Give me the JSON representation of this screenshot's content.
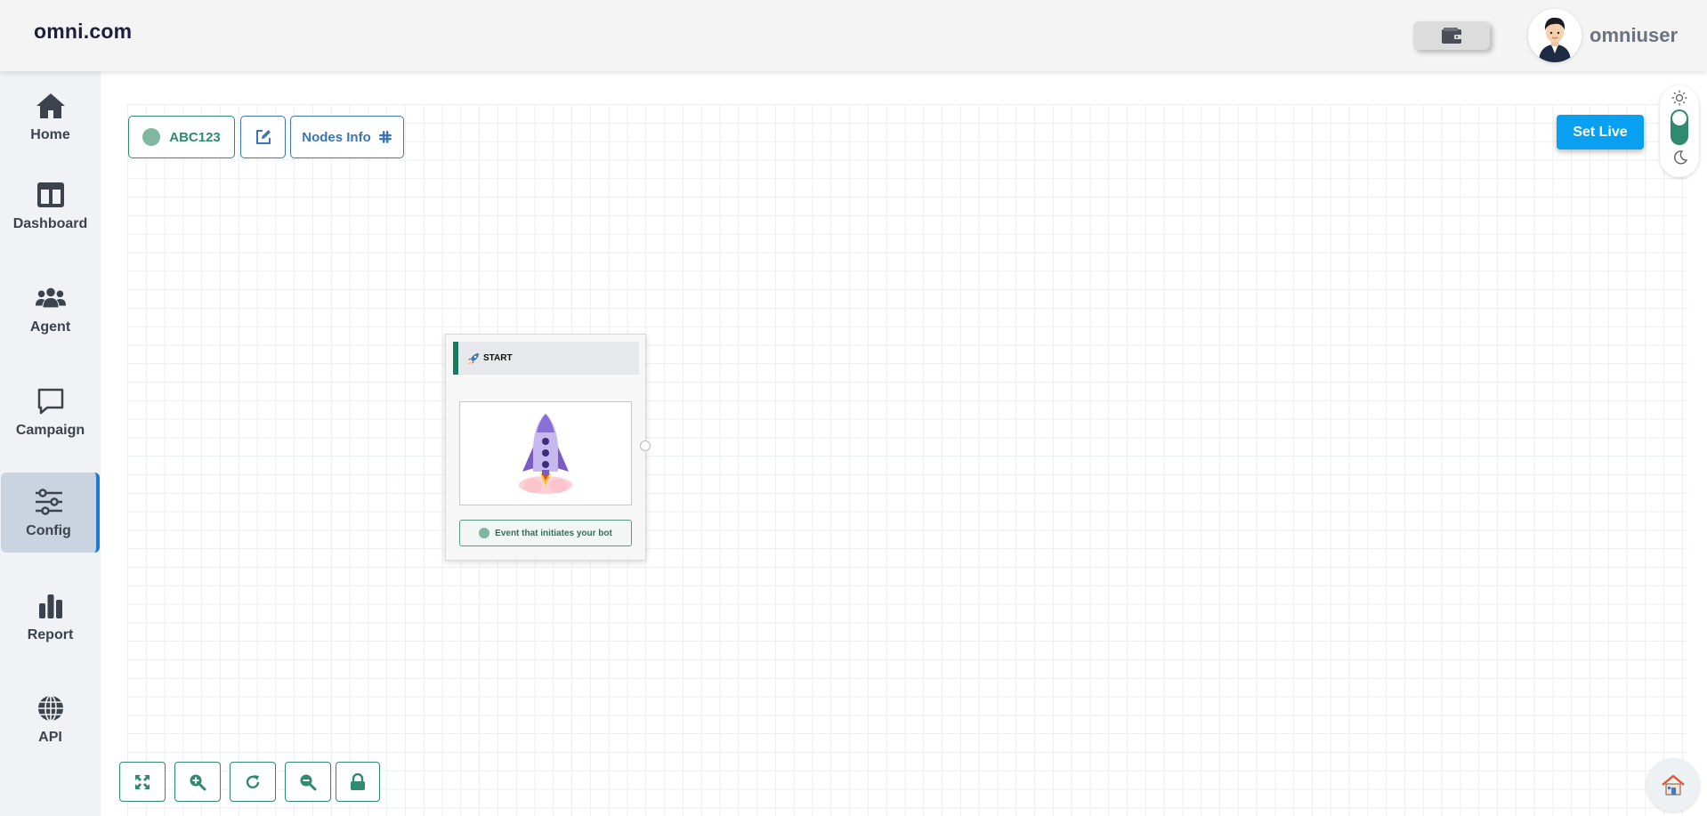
{
  "header": {
    "brand": "omni.com",
    "username": "omniuser"
  },
  "sidebar": {
    "items": [
      {
        "label": "Home",
        "icon": "home-icon"
      },
      {
        "label": "Dashboard",
        "icon": "dashboard-icon"
      },
      {
        "label": "Agent",
        "icon": "users-icon"
      },
      {
        "label": "Campaign",
        "icon": "chat-icon"
      },
      {
        "label": "Config",
        "icon": "sliders-icon",
        "active": true
      },
      {
        "label": "Report",
        "icon": "bar-chart-icon"
      },
      {
        "label": "API",
        "icon": "globe-icon"
      }
    ]
  },
  "toolbar": {
    "bot_name": "ABC123",
    "nodes_info_label": "Nodes Info",
    "set_live_label": "Set Live"
  },
  "start_node": {
    "title": "START",
    "description": "Event that initiates your bot"
  },
  "colors": {
    "accent_green": "#2f8a70",
    "accent_blue": "#3b74b8",
    "set_live_blue": "#0aa0f2",
    "sidebar_active_border": "#1f78d1"
  }
}
